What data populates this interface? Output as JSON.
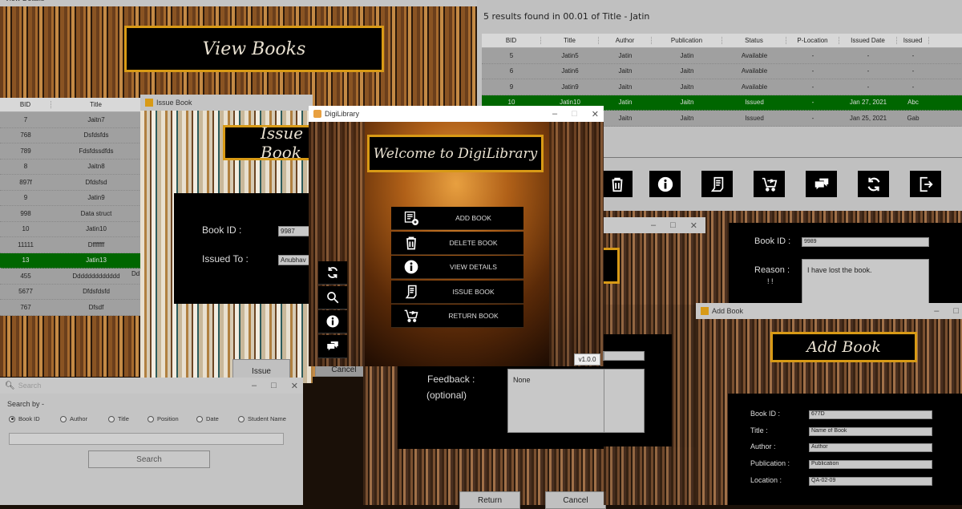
{
  "view_details": {
    "title": "View Details",
    "banner": "View Books",
    "columns": [
      "BID",
      "Title"
    ],
    "rows": [
      {
        "bid": "7",
        "title": "Jaitn7"
      },
      {
        "bid": "768",
        "title": "Dsfdsfds"
      },
      {
        "bid": "789",
        "title": "Fdsfdssdfds"
      },
      {
        "bid": "8",
        "title": "Jaitn8"
      },
      {
        "bid": "897f",
        "title": "Dfdsfsd"
      },
      {
        "bid": "9",
        "title": "Jatin9"
      },
      {
        "bid": "998",
        "title": "Data struct"
      },
      {
        "bid": "10",
        "title": "Jatin10"
      },
      {
        "bid": "11111",
        "title": "Dfffffff"
      },
      {
        "bid": "13",
        "title": "Jatin13"
      },
      {
        "bid": "455",
        "title": "Ddddddddddddd"
      },
      {
        "bid": "5677",
        "title": "Dfdsfdsfd"
      },
      {
        "bid": "767",
        "title": "Dfsdf"
      }
    ],
    "selected_index": 9,
    "overflow_text": "Dd"
  },
  "search_results": {
    "summary": "5 results found in 00.01 of Title - Jatin",
    "columns": [
      "BID",
      "Title",
      "Author",
      "Publication",
      "Status",
      "P-Location",
      "Issued Date",
      "Issued"
    ],
    "rows": [
      [
        "5",
        "Jatin5",
        "Jatin",
        "Jatin",
        "Available",
        "-",
        "-",
        "-"
      ],
      [
        "6",
        "Jatin6",
        "Jaitn",
        "Jaitn",
        "Available",
        "-",
        "-",
        "-"
      ],
      [
        "9",
        "Jatin9",
        "Jaitn",
        "Jaitn",
        "Available",
        "-",
        "-",
        "-"
      ],
      [
        "10",
        "Jatin10",
        "Jatin",
        "Jaitn",
        "Issued",
        "-",
        "Jan 27, 2021",
        "Abc"
      ],
      [
        "",
        "",
        "Jaitn",
        "Jaitn",
        "Issued",
        "-",
        "Jan 25, 2021",
        "Gab"
      ]
    ],
    "selected_index": 3,
    "toolbar_icons": [
      "trash-icon",
      "info-icon",
      "issue-icon",
      "return-cart-icon",
      "feedback-icon",
      "refresh-icon",
      "exit-icon"
    ]
  },
  "issue_book": {
    "title": "Issue Book",
    "banner": "Issue Book",
    "book_id_label": "Book ID :",
    "book_id_value": "9987",
    "issued_to_label": "Issued To :",
    "issued_to_value": "Anubhav",
    "issue_button": "Issue",
    "cancel_button": "Cancel"
  },
  "digilibrary": {
    "title": "DigiLibrary",
    "banner": "Welcome to DigiLibrary",
    "menu": [
      "ADD BOOK",
      "DELETE BOOK",
      "VIEW DETAILS",
      "ISSUE BOOK",
      "RETURN BOOK"
    ],
    "side_icons": [
      "refresh-icon",
      "search-icon",
      "info-icon",
      "feedback-icon"
    ],
    "version": "v1.0.0"
  },
  "return_book": {
    "feedback_label": "Feedback :",
    "feedback_optional": "(optional)",
    "feedback_value": "None",
    "return_button": "Return",
    "cancel_button": "Cancel"
  },
  "delete_book": {
    "book_id_label": "Book ID :",
    "book_id_value": "9989",
    "reason_label": "Reason :",
    "reason_sub": "! !",
    "reason_value": "I have lost the book."
  },
  "add_book": {
    "title": "Add Book",
    "banner": "Add Book",
    "fields": [
      {
        "label": "Book ID :",
        "value": "677D"
      },
      {
        "label": "Title :",
        "value": "Name of Book"
      },
      {
        "label": "Author :",
        "value": "Author"
      },
      {
        "label": "Publication :",
        "value": "Publication"
      },
      {
        "label": "Location :",
        "value": "QA-02-09"
      }
    ]
  },
  "search": {
    "title": "Search",
    "search_by_label": "Search by -",
    "options": [
      "Book ID",
      "Author",
      "Title",
      "Position",
      "Date",
      "Student Name"
    ],
    "selected_option": 0,
    "query": "",
    "search_button": "Search"
  },
  "colors": {
    "banner_border": "#d89a16",
    "selected_row": "#006600",
    "grid_row": "#a0a0a0"
  }
}
